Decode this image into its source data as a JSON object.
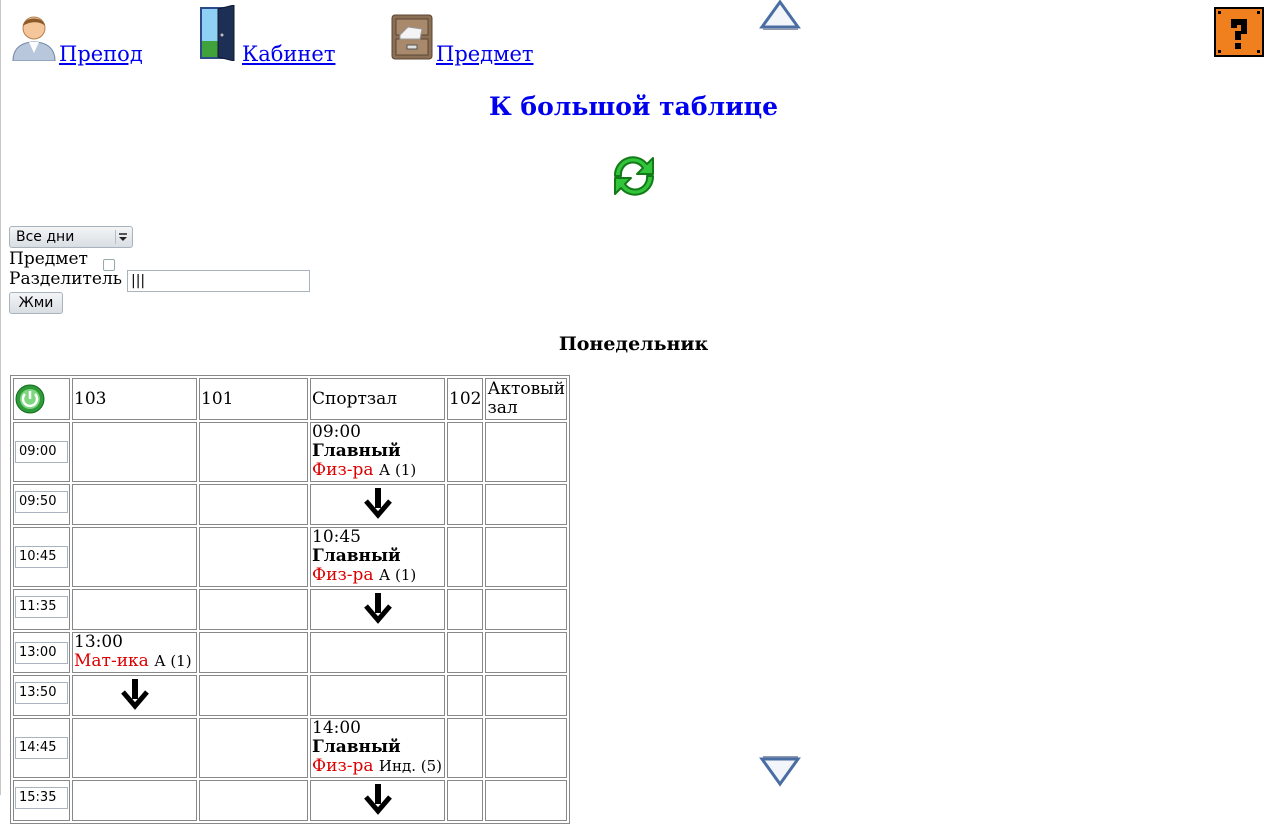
{
  "nav": {
    "teacher_label": "Препод",
    "room_label": "Кабинет",
    "subject_label": "Предмет"
  },
  "big_table_link": "К большой таблице",
  "controls": {
    "day_select_value": "Все дни",
    "subject_label": "Предмет",
    "separator_label": "Разделитель",
    "separator_value": "|||",
    "submit_label": "Жми"
  },
  "day_heading": "Понедельник",
  "columns": [
    "103",
    "101",
    "Спортзал",
    "102",
    "Актовый зал"
  ],
  "times": [
    "09:00",
    "09:50",
    "10:45",
    "11:35",
    "13:00",
    "13:50",
    "14:45",
    "15:35"
  ],
  "cells": {
    "r0_c3": {
      "time": "09:00",
      "teacher": "Главный",
      "subject": "Физ-ра",
      "group": "А (1)"
    },
    "r2_c3": {
      "time": "10:45",
      "teacher": "Главный",
      "subject": "Физ-ра",
      "group": "А (1)"
    },
    "r4_c1": {
      "time": "13:00",
      "subject": "Мат-ика",
      "group": "А (1)"
    },
    "r6_c3": {
      "time": "14:00",
      "teacher": "Главный",
      "subject": "Физ-ра",
      "group": "Инд. (5)"
    }
  },
  "colors": {
    "link": "#0000ee",
    "subject": "#dd0000"
  },
  "icons": [
    "teacher-icon",
    "door-icon",
    "cabinet-icon",
    "up-arrow-icon",
    "down-arrow-icon",
    "help-icon",
    "refresh-icon",
    "power-icon",
    "down-arrow-icon"
  ]
}
